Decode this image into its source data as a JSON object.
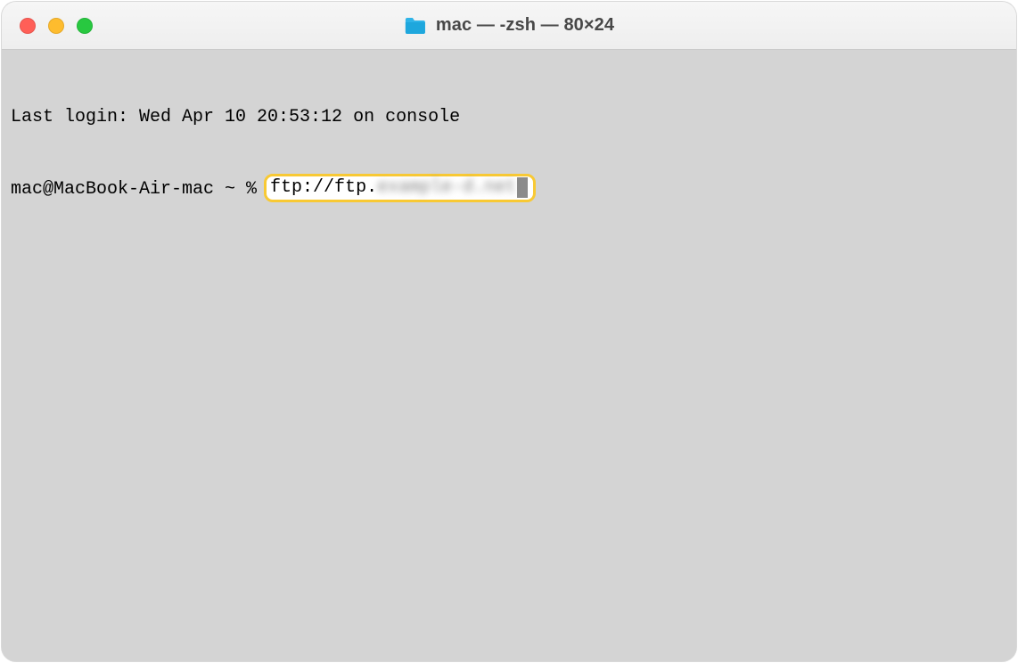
{
  "titlebar": {
    "title": "mac — -zsh — 80×24"
  },
  "terminal": {
    "last_login_line": "Last login: Wed Apr 10 20:53:12 on console",
    "prompt": "mac@MacBook-Air-mac ~ % ",
    "command_visible": "ftp://ftp.",
    "command_blurred": "example-d.net"
  }
}
